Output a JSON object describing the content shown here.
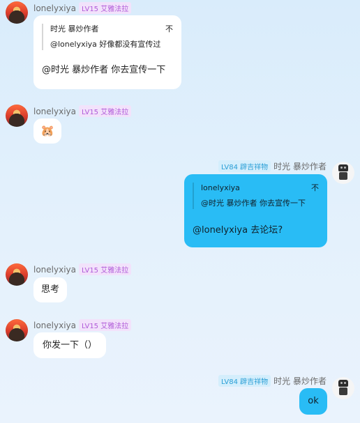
{
  "messages": [
    {
      "side": "left",
      "nick": "lonelyxiya",
      "badge": "LV15 艾雅法拉",
      "quote": {
        "author": "时光 暴炒作者",
        "tail": "不",
        "text": "@lonelyxiya 好像都没有宣传过"
      },
      "text": "@时光 暴炒作者 你去宣传一下"
    },
    {
      "side": "left",
      "nick": "lonelyxiya",
      "badge": "LV15 艾雅法拉",
      "emoji": "🐹"
    },
    {
      "side": "right",
      "nick": "时光 暴炒作者",
      "badge": "LV84 辟吉祥物",
      "quote": {
        "author": "lonelyxiya",
        "tail": "不",
        "text": "@时光 暴炒作者 你去宣传一下"
      },
      "text": "@lonelyxiya 去论坛?"
    },
    {
      "side": "left",
      "nick": "lonelyxiya",
      "badge": "LV15 艾雅法拉",
      "text": "思考"
    },
    {
      "side": "left",
      "nick": "lonelyxiya",
      "badge": "LV15 艾雅法拉",
      "text": "你发一下（）"
    },
    {
      "side": "right",
      "nick": "时光 暴炒作者",
      "badge": "LV84 辟吉祥物",
      "text": "ok"
    }
  ]
}
